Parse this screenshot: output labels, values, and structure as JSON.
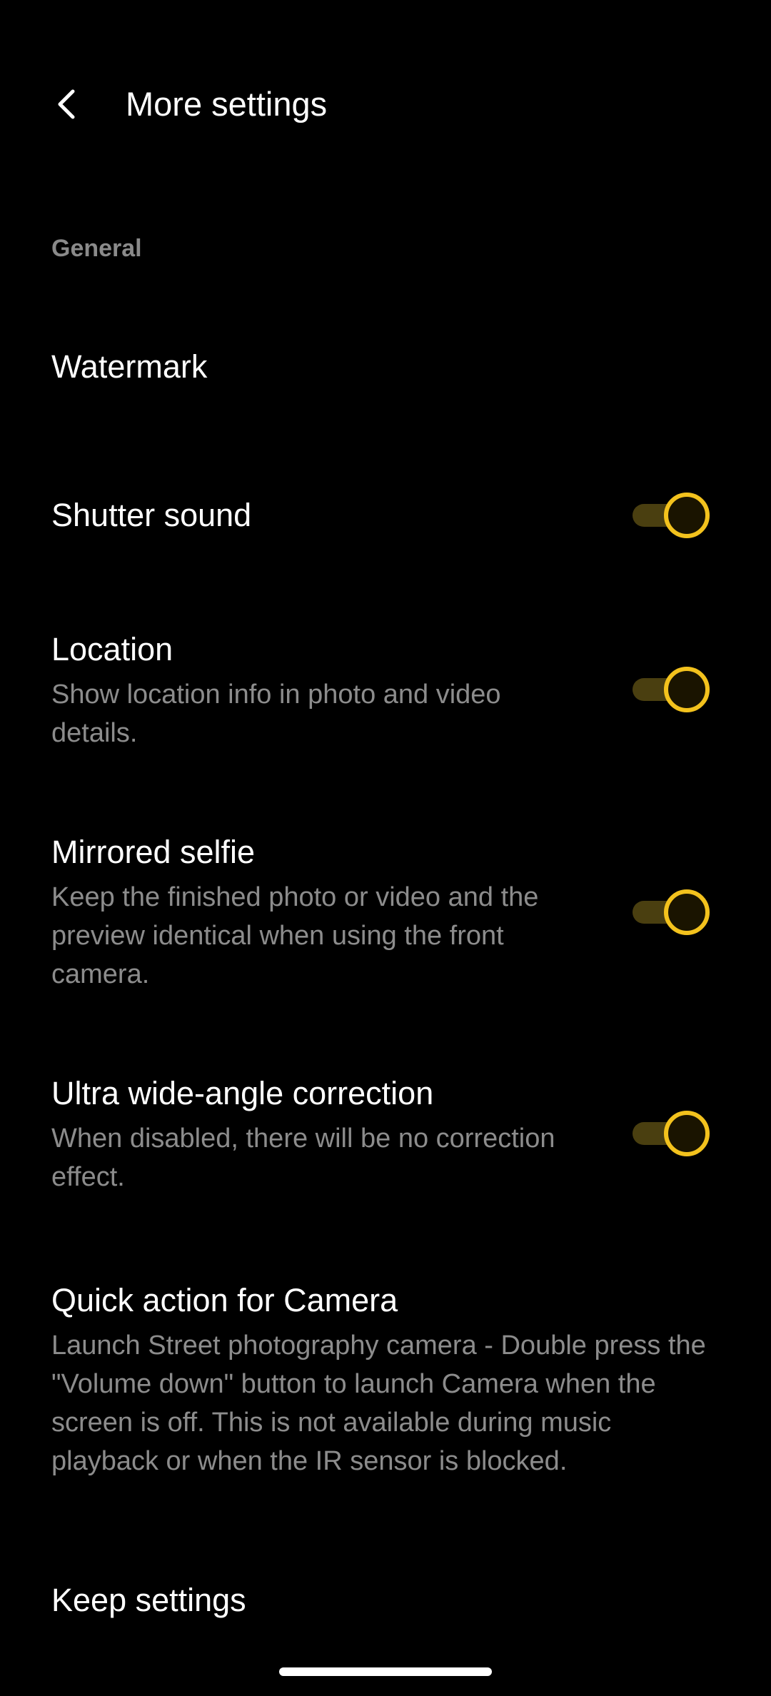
{
  "header": {
    "title": "More settings",
    "back_icon": "chevron-left-icon"
  },
  "sections": {
    "general_label": "General"
  },
  "items": {
    "watermark": {
      "title": "Watermark"
    },
    "shutter_sound": {
      "title": "Shutter sound",
      "enabled": true
    },
    "location": {
      "title": "Location",
      "desc": "Show location info in photo and video details.",
      "enabled": true
    },
    "mirrored_selfie": {
      "title": "Mirrored selfie",
      "desc": "Keep the finished photo or video and the preview identical when using the front camera.",
      "enabled": true
    },
    "ultra_wide": {
      "title": "Ultra wide-angle correction",
      "desc": "When disabled, there will be no correction effect.",
      "enabled": true
    },
    "quick_action": {
      "title": "Quick action for Camera",
      "desc": "Launch Street photography camera - Double press the \"Volume down\" button to launch Camera when the screen is off. This is not available during music playback or when the IR sensor is blocked."
    },
    "keep_settings": {
      "title": "Keep settings"
    }
  },
  "colors": {
    "background": "#000000",
    "accent": "#f3c21d",
    "track": "#4a3f10",
    "secondary_text": "#8c8c8c"
  }
}
